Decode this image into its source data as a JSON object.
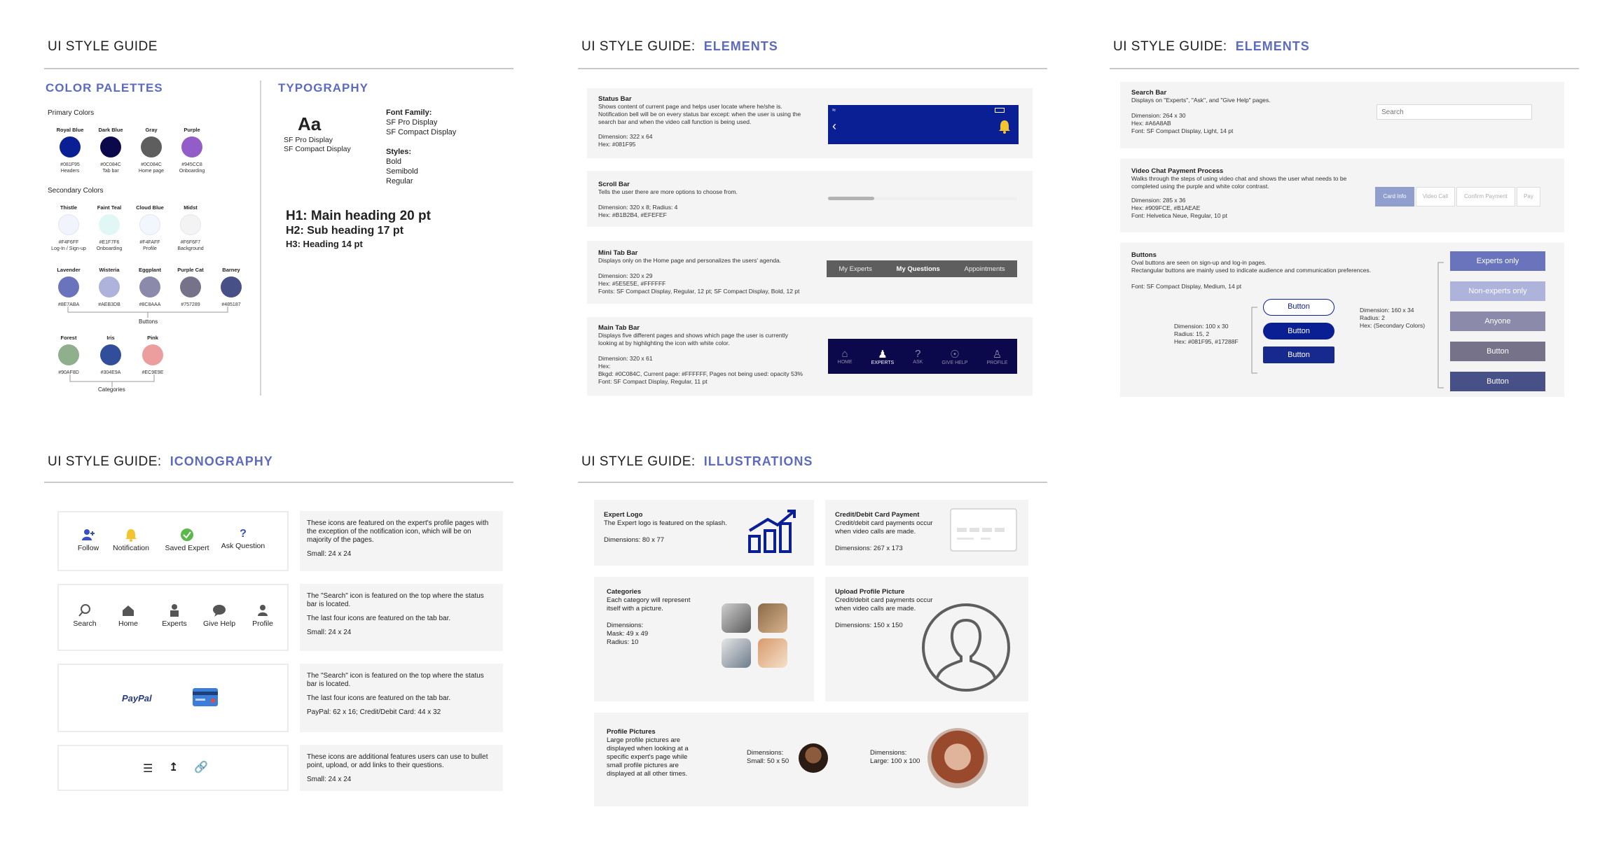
{
  "panel1": {
    "title": "UI STYLE GUIDE",
    "color_palettes": "COLOR PALETTES",
    "primary_label": "Primary Colors",
    "primary": [
      {
        "name": "Royal Blue",
        "hex": "#081F95",
        "use": "Headers",
        "color": "#0b1f95"
      },
      {
        "name": "Dark Blue",
        "hex": "#0C084C",
        "use": "Tab bar",
        "color": "#0c084c"
      },
      {
        "name": "Gray",
        "hex": "#0C084C",
        "use": "Home page",
        "color": "#5e5e5e"
      },
      {
        "name": "Purple",
        "hex": "#945CC8",
        "use": "Onboarding",
        "color": "#945cc8"
      }
    ],
    "secondary_label": "Secondary Colors",
    "secondary": [
      {
        "name": "Thistle",
        "hex": "#F4F6FF",
        "use": "Log-In / Sign-up",
        "color": "#f1f3fd"
      },
      {
        "name": "Faint Teal",
        "hex": "#E1F7F6",
        "use": "Onboarding",
        "color": "#e1f7f6"
      },
      {
        "name": "Cloud Blue",
        "hex": "#F4FAFF",
        "use": "Profile",
        "color": "#f1f7fd"
      },
      {
        "name": "Midst",
        "hex": "#F6F6F7",
        "use": "Background",
        "color": "#f3f3f4"
      }
    ],
    "button_colors": [
      {
        "name": "Lavender",
        "hex": "#8E7ABA",
        "color": "#6a74bd"
      },
      {
        "name": "Wisteria",
        "hex": "#AEB3DB",
        "color": "#aeb3db"
      },
      {
        "name": "Eggplant",
        "hex": "#8C8AAA",
        "color": "#8c8aaa"
      },
      {
        "name": "Purple Cat",
        "hex": "#757289",
        "color": "#757289"
      },
      {
        "name": "Barney",
        "hex": "#485187",
        "color": "#485187"
      }
    ],
    "buttons_label": "Buttons",
    "category_colors": [
      {
        "name": "Forest",
        "hex": "#90AF8D",
        "color": "#90af8d"
      },
      {
        "name": "Iris",
        "hex": "#304E9A",
        "color": "#304e9a"
      },
      {
        "name": "Pink",
        "hex": "#EC9E9E",
        "color": "#ec9e9e"
      }
    ],
    "categories_label": "Categories",
    "typography": "TYPOGRAPHY",
    "aa": "Aa",
    "aa_font1": "SF Pro Display",
    "aa_font2": "SF Compact Display",
    "font_family_label": "Font Family:",
    "font_family_1": "SF Pro Display",
    "font_family_2": "SF Compact Display",
    "styles_label": "Styles:",
    "style_1": "Bold",
    "style_2": "Semibold",
    "style_3": "Regular",
    "h1": "H1: Main heading 20 pt",
    "h2": "H2: Sub heading 17 pt",
    "h3": "H3: Heading 14 pt"
  },
  "panel2": {
    "title": "UI STYLE GUIDE:",
    "accent": "ELEMENTS",
    "status_bar": {
      "heading": "Status Bar",
      "desc": "Shows content of current page and helps user locate where he/she is. Notification bell will be on every status bar except: when the user is using the search bar and when the video call function is being used.",
      "dim": "Dimension: 322 x 64",
      "hex": "Hex: #081F95"
    },
    "scroll_bar": {
      "heading": "Scroll Bar",
      "desc": "Tells the user there are more options to choose from.",
      "dim": "Dimension: 320 x 8; Radius: 4",
      "hex": "Hex: #B1B2B4, #EFEFEF"
    },
    "mini_tab": {
      "heading": "Mini Tab Bar",
      "desc": "Displays only on the Home page and personalizes the users' agenda.",
      "dim": "Dimension: 320 x 29",
      "hex": "Hex: #5E5E5E, #FFFFFF",
      "fonts": "Fonts: SF Compact Display, Regular, 12 pt; SF Compact Display, Bold, 12 pt",
      "tabs": [
        "My Experts",
        "My Questions",
        "Appointments"
      ]
    },
    "main_tab": {
      "heading": "Main Tab Bar",
      "desc": "Displays five different pages and shows which page the user is currently looking at by highlighting the icon with white color.",
      "dim": "Dimension: 320 x 61",
      "hex": "Hex:",
      "bkgd": "Bkgd: #0C084C, Current page: #FFFFFF, Pages not being used: opacity 53%",
      "font": "Font: SF Compact Display, Regular, 11 pt",
      "tabs": [
        "HOME",
        "EXPERTS",
        "ASK",
        "GIVE HELP",
        "PROFILE"
      ]
    }
  },
  "panel3": {
    "title": "UI STYLE GUIDE:",
    "accent": "ELEMENTS",
    "search_bar": {
      "heading": "Search Bar",
      "desc": "Displays on \"Experts\", \"Ask\", and \"Give Help\" pages.",
      "dim": "Dimension: 264 x 30",
      "hex": "Hex: #A6A8AB",
      "font": "Font: SF Compact Display, Light, 14 pt",
      "placeholder": "Search"
    },
    "video_chat": {
      "heading": "Video Chat Payment Process",
      "desc": "Walks through the steps of using video chat and shows the user what needs to be completed using the purple and white color contrast.",
      "dim": "Dimension: 285 x 36",
      "hex": "Hex: #909FCE, #B1AEAE",
      "font": "Font: Helvetica Neue, Regular, 10 pt",
      "steps": [
        "Card Info",
        "Video Call",
        "Confirm Payment",
        "Pay"
      ]
    },
    "buttons": {
      "heading": "Buttons",
      "desc1": "Oval buttons are seen on sign-up and log-in pages.",
      "desc2": "Rectangular buttons are mainly used to indicate audience and communication preferences.",
      "font": "Font: SF Compact Display, Medium, 14 pt",
      "oval_dim": "Dimension: 100 x 30",
      "oval_radius": "Radius: 15, 2",
      "oval_hex": "Hex: #081F95, #17288F",
      "oval_buttons": [
        "Button",
        "Button",
        "Button"
      ],
      "rect_dim": "Dimension: 160 x 34",
      "rect_radius": "Radius: 2",
      "rect_hex": "Hex: (Secondary Colors)",
      "rect_buttons": [
        "Experts only",
        "Non-experts only",
        "Anyone",
        "Button",
        "Button"
      ]
    }
  },
  "panel4": {
    "title": "UI STYLE GUIDE:",
    "accent": "ICONOGRAPHY",
    "row1_icons": [
      "Follow",
      "Notification",
      "Saved Expert",
      "Ask Question"
    ],
    "row1_note": "These icons are featured on the expert's profile pages with the exception of the notification icon, which will be on majority of the pages.",
    "row1_size": "Small: 24 x 24",
    "row2_icons": [
      "Search",
      "Home",
      "Experts",
      "Give Help",
      "Profile"
    ],
    "row2_note1": "The \"Search\" icon is featured on the top where the status bar is located.",
    "row2_note2": "The last four icons are featured on the tab bar.",
    "row2_size": "Small: 24 x 24",
    "paypal": "PayPal",
    "row3_note1": "The \"Search\" icon is featured on the top where the status bar is located.",
    "row3_note2": "The last four icons are featured on the tab bar.",
    "row3_size": "PayPal: 62 x 16;  Credit/Debit Card: 44 x 32",
    "row4_note": "These icons are additional features users can use to bullet point, upload, or add links to their questions.",
    "row4_size": "Small: 24 x 24"
  },
  "panel5": {
    "title": "UI STYLE GUIDE:",
    "accent": "ILLUSTRATIONS",
    "expert_logo": {
      "heading": "Expert Logo",
      "desc": "The Expert logo is featured on the splash.",
      "dim": "Dimensions: 80 x 77"
    },
    "credit_card": {
      "heading": "Credit/Debit Card Payment",
      "desc": "Credit/debit card payments occur when video calls are made.",
      "dim": "Dimensions: 267 x 173"
    },
    "categories": {
      "heading": "Categories",
      "desc": "Each category will represent itself with a picture.",
      "dim_label": "Dimensions:",
      "mask": "Mask: 49 x 49",
      "radius": "Radius: 10"
    },
    "upload": {
      "heading": "Upload Profile Picture",
      "desc": "Credit/debit card payments occur when video calls are made.",
      "dim": "Dimensions: 150 x 150"
    },
    "profile": {
      "heading": "Profile Pictures",
      "desc": "Large profile pictures are displayed when looking at a specific expert's page while small profile pictures are displayed at all other times.",
      "small_label": "Dimensions:",
      "small": "Small: 50 x 50",
      "large_label": "Dimensions:",
      "large": "Large: 100 x 100"
    }
  }
}
